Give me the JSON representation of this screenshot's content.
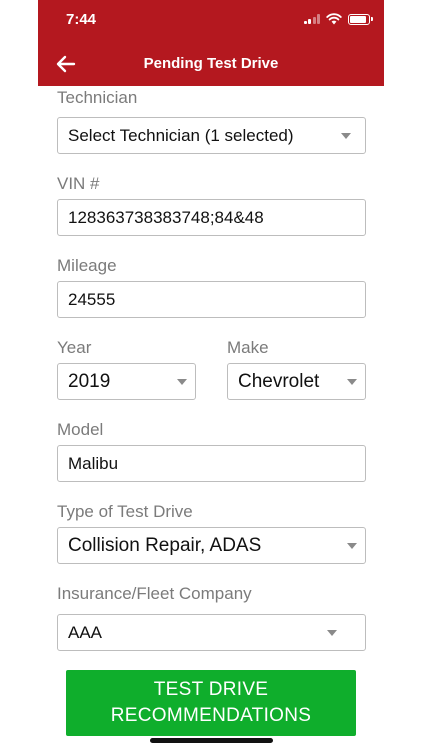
{
  "status_bar": {
    "time": "7:44"
  },
  "header": {
    "title": "Pending Test Drive"
  },
  "form": {
    "technician": {
      "label": "Technician",
      "value": "Select Technician (1 selected)"
    },
    "vin": {
      "label": "VIN #",
      "value": "128363738383748;84&48"
    },
    "mileage": {
      "label": "Mileage",
      "value": "24555"
    },
    "year": {
      "label": "Year",
      "value": "2019"
    },
    "make": {
      "label": "Make",
      "value": "Chevrolet"
    },
    "model": {
      "label": "Model",
      "value": "Malibu"
    },
    "test_drive_type": {
      "label": "Type of Test Drive",
      "value": "Collision Repair, ADAS"
    },
    "insurance": {
      "label": "Insurance/Fleet Company",
      "value": "AAA"
    }
  },
  "cta": {
    "line1": "TEST DRIVE",
    "line2": "RECOMMENDATIONS"
  },
  "colors": {
    "header_bg": "#b4181f",
    "cta_bg": "#0fae2c",
    "label": "#7b7b7b",
    "border": "#bdbdbd"
  },
  "status_indicators": {
    "battery_level": 0.9,
    "signal_bars": 2
  }
}
